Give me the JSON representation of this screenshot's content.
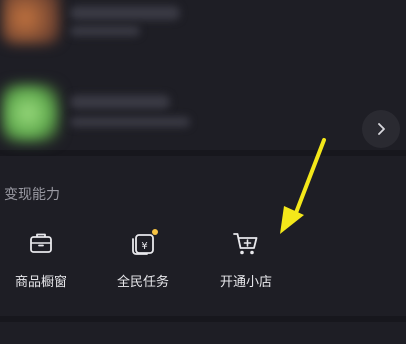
{
  "section": {
    "title": "变现能力",
    "features": [
      {
        "label": "商品橱窗",
        "icon": "storefront-icon"
      },
      {
        "label": "全民任务",
        "icon": "task-icon",
        "has_dot": true
      },
      {
        "label": "开通小店",
        "icon": "cart-add-icon"
      }
    ]
  },
  "colors": {
    "background": "#17171d",
    "card": "#1e1e25",
    "badge_dot": "#f6c343",
    "annotation_arrow": "#f4e81a"
  },
  "icons": {
    "next": "chevron-right-icon"
  }
}
